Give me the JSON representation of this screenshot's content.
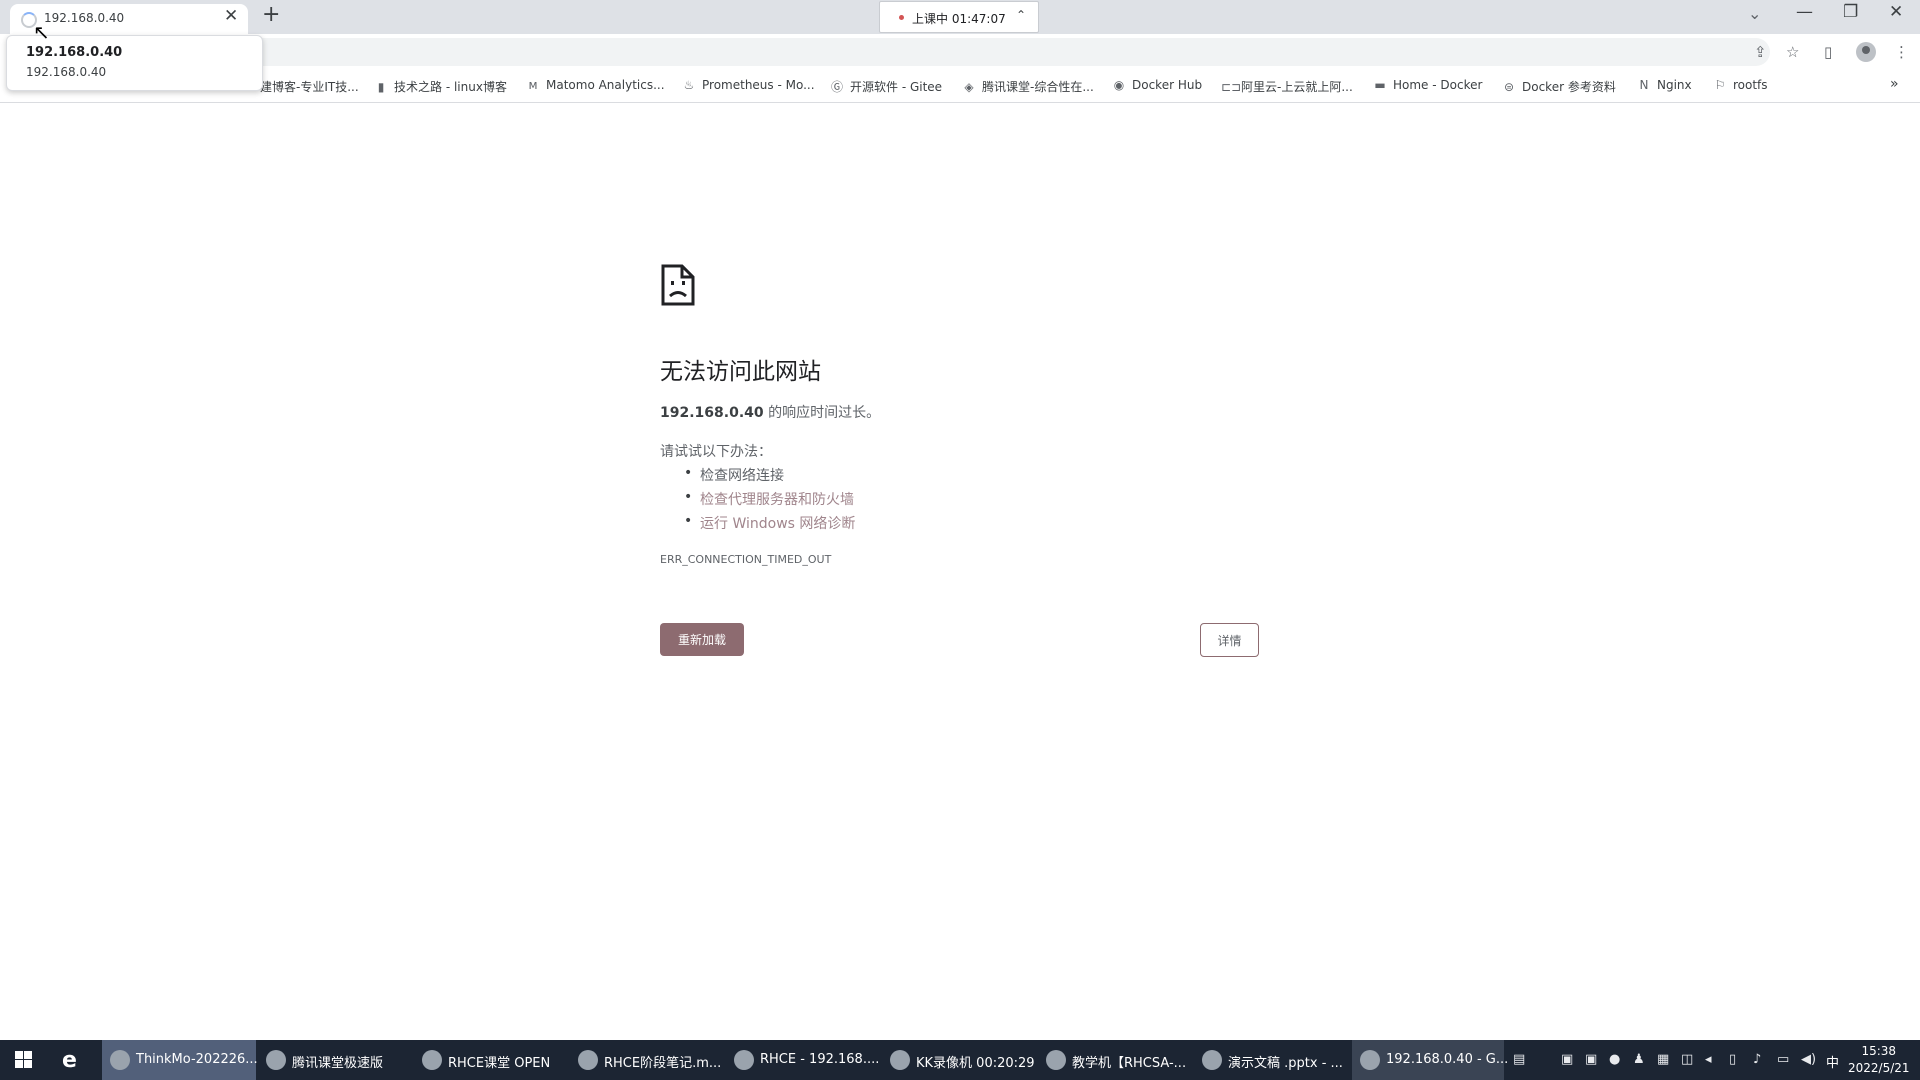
{
  "browser": {
    "tab": {
      "title": "192.168.0.40",
      "close_glyph": "✕"
    },
    "new_tab_glyph": "+",
    "tab_search_glyph": "⌄",
    "window_controls": {
      "minimize": "—",
      "restore": "❐",
      "close": "✕"
    },
    "class_indicator": {
      "text": "上课中 01:47:07",
      "chevron": "⌃"
    },
    "tooltip": {
      "title": "192.168.0.40",
      "url": "192.168.0.40"
    },
    "toolbar_icons": {
      "share": "⇪",
      "star": "☆",
      "sidepanel": "▯",
      "menu": "⋮"
    },
    "bookmarks": [
      {
        "label": "建博客-专业IT技...",
        "icon": "blog-icon"
      },
      {
        "label": "技术之路 - linux博客",
        "icon": "bookmark-icon"
      },
      {
        "label": "Matomo Analytics...",
        "icon": "matomo-icon"
      },
      {
        "label": "Prometheus - Mo...",
        "icon": "prometheus-icon"
      },
      {
        "label": "开源软件 - Gitee",
        "icon": "gitee-icon"
      },
      {
        "label": "腾讯课堂-综合性在...",
        "icon": "tencent-icon"
      },
      {
        "label": "Docker Hub",
        "icon": "docker-icon"
      },
      {
        "label": "阿里云-上云就上阿...",
        "icon": "aliyun-icon"
      },
      {
        "label": "Home - Docker",
        "icon": "docker-whale-icon"
      },
      {
        "label": "Docker 参考资料",
        "icon": "docs-icon"
      },
      {
        "label": "Nginx",
        "icon": "nginx-icon"
      },
      {
        "label": "rootfs",
        "icon": "rootfs-icon"
      }
    ],
    "bookmarks_overflow": "»"
  },
  "error_page": {
    "title": "无法访问此网站",
    "host": "192.168.0.40",
    "subtitle_suffix": " 的响应时间过长。",
    "try_label": "请试试以下办法：",
    "suggestions": [
      "检查网络连接",
      "检查代理服务器和防火墙",
      "运行 Windows 网络诊断"
    ],
    "error_code": "ERR_CONNECTION_TIMED_OUT",
    "reload_label": "重新加载",
    "details_label": "详情"
  },
  "taskbar": {
    "items": [
      {
        "label": "ThinkMo-202226..."
      },
      {
        "label": "腾讯课堂极速版"
      },
      {
        "label": "RHCE课堂 OPEN"
      },
      {
        "label": "RHCE阶段笔记.m..."
      },
      {
        "label": "RHCE  - 192.168...."
      },
      {
        "label": "KK录像机 00:20:29"
      },
      {
        "label": "教学机【RHCSA-..."
      },
      {
        "label": "演示文稿 .pptx - ..."
      },
      {
        "label": "192.168.0.40 - G..."
      }
    ],
    "ime": "中",
    "time": "15:38",
    "date": "2022/5/21"
  }
}
